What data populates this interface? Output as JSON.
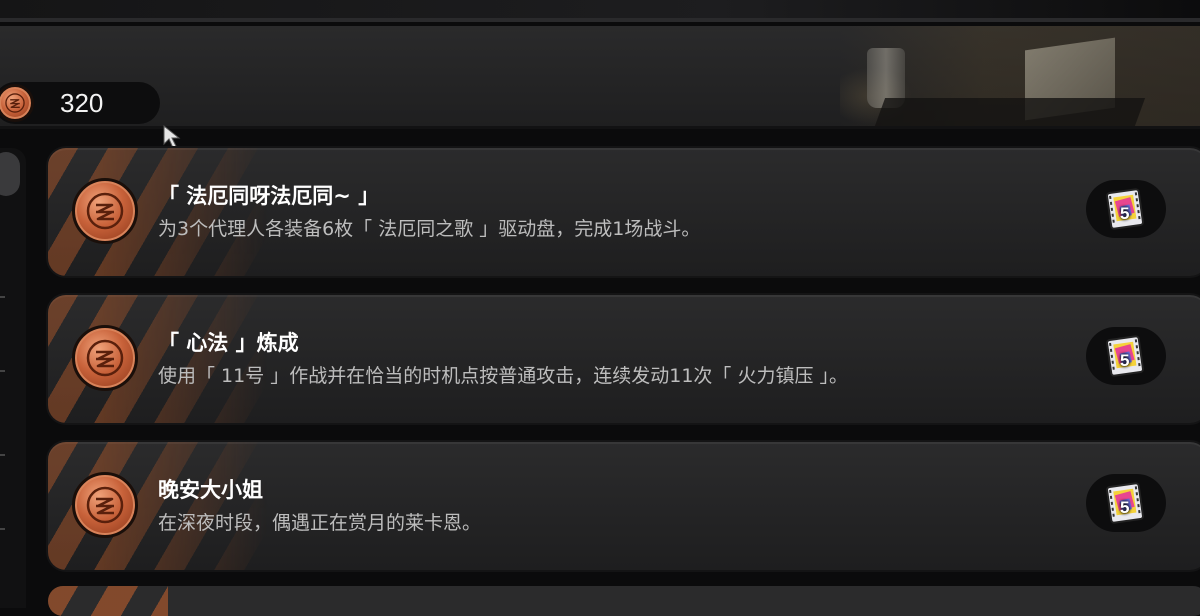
{
  "header": {
    "currency": {
      "icon": "zenless-coin-icon",
      "value": "320"
    }
  },
  "quests": [
    {
      "title": "「 法厄同呀法厄同~ 」",
      "description": "为3个代理人各装备6枚「 法厄同之歌 」驱动盘，完成1场战斗。",
      "reward": {
        "icon": "film-reel-icon",
        "count": "5"
      }
    },
    {
      "title": "「 心法 」炼成",
      "description": "使用「 11号 」作战并在恰当的时机点按普通攻击，连续发动11次「 火力镇压 」。",
      "reward": {
        "icon": "film-reel-icon",
        "count": "5"
      }
    },
    {
      "title": "晚安大小姐",
      "description": "在深夜时段，偶遇正在赏月的莱卡恩。",
      "reward": {
        "icon": "film-reel-icon",
        "count": "5"
      }
    }
  ],
  "colors": {
    "accent_orange": "#c9622b",
    "card_bg": "#252526",
    "text_primary": "#ffffff",
    "text_secondary": "#bdbdbd"
  }
}
